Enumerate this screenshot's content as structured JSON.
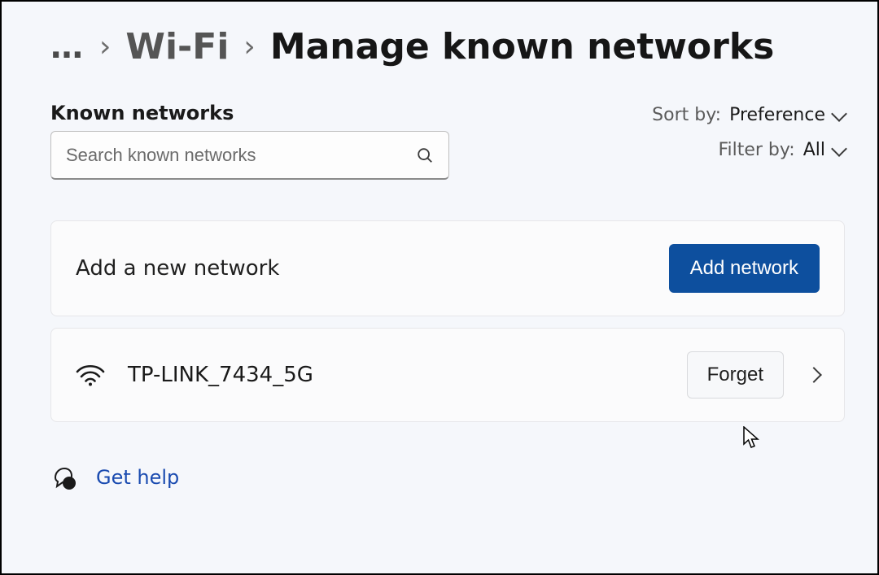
{
  "breadcrumb": {
    "ellipsis": "…",
    "prev": "Wi-Fi",
    "current": "Manage known networks"
  },
  "section_label": "Known networks",
  "search": {
    "placeholder": "Search known networks"
  },
  "sort": {
    "label": "Sort by:",
    "value": "Preference"
  },
  "filter": {
    "label": "Filter by:",
    "value": "All"
  },
  "add_card": {
    "title": "Add a new network",
    "button": "Add network"
  },
  "networks": [
    {
      "name": "TP-LINK_7434_5G",
      "forget": "Forget"
    }
  ],
  "help": {
    "label": "Get help"
  }
}
